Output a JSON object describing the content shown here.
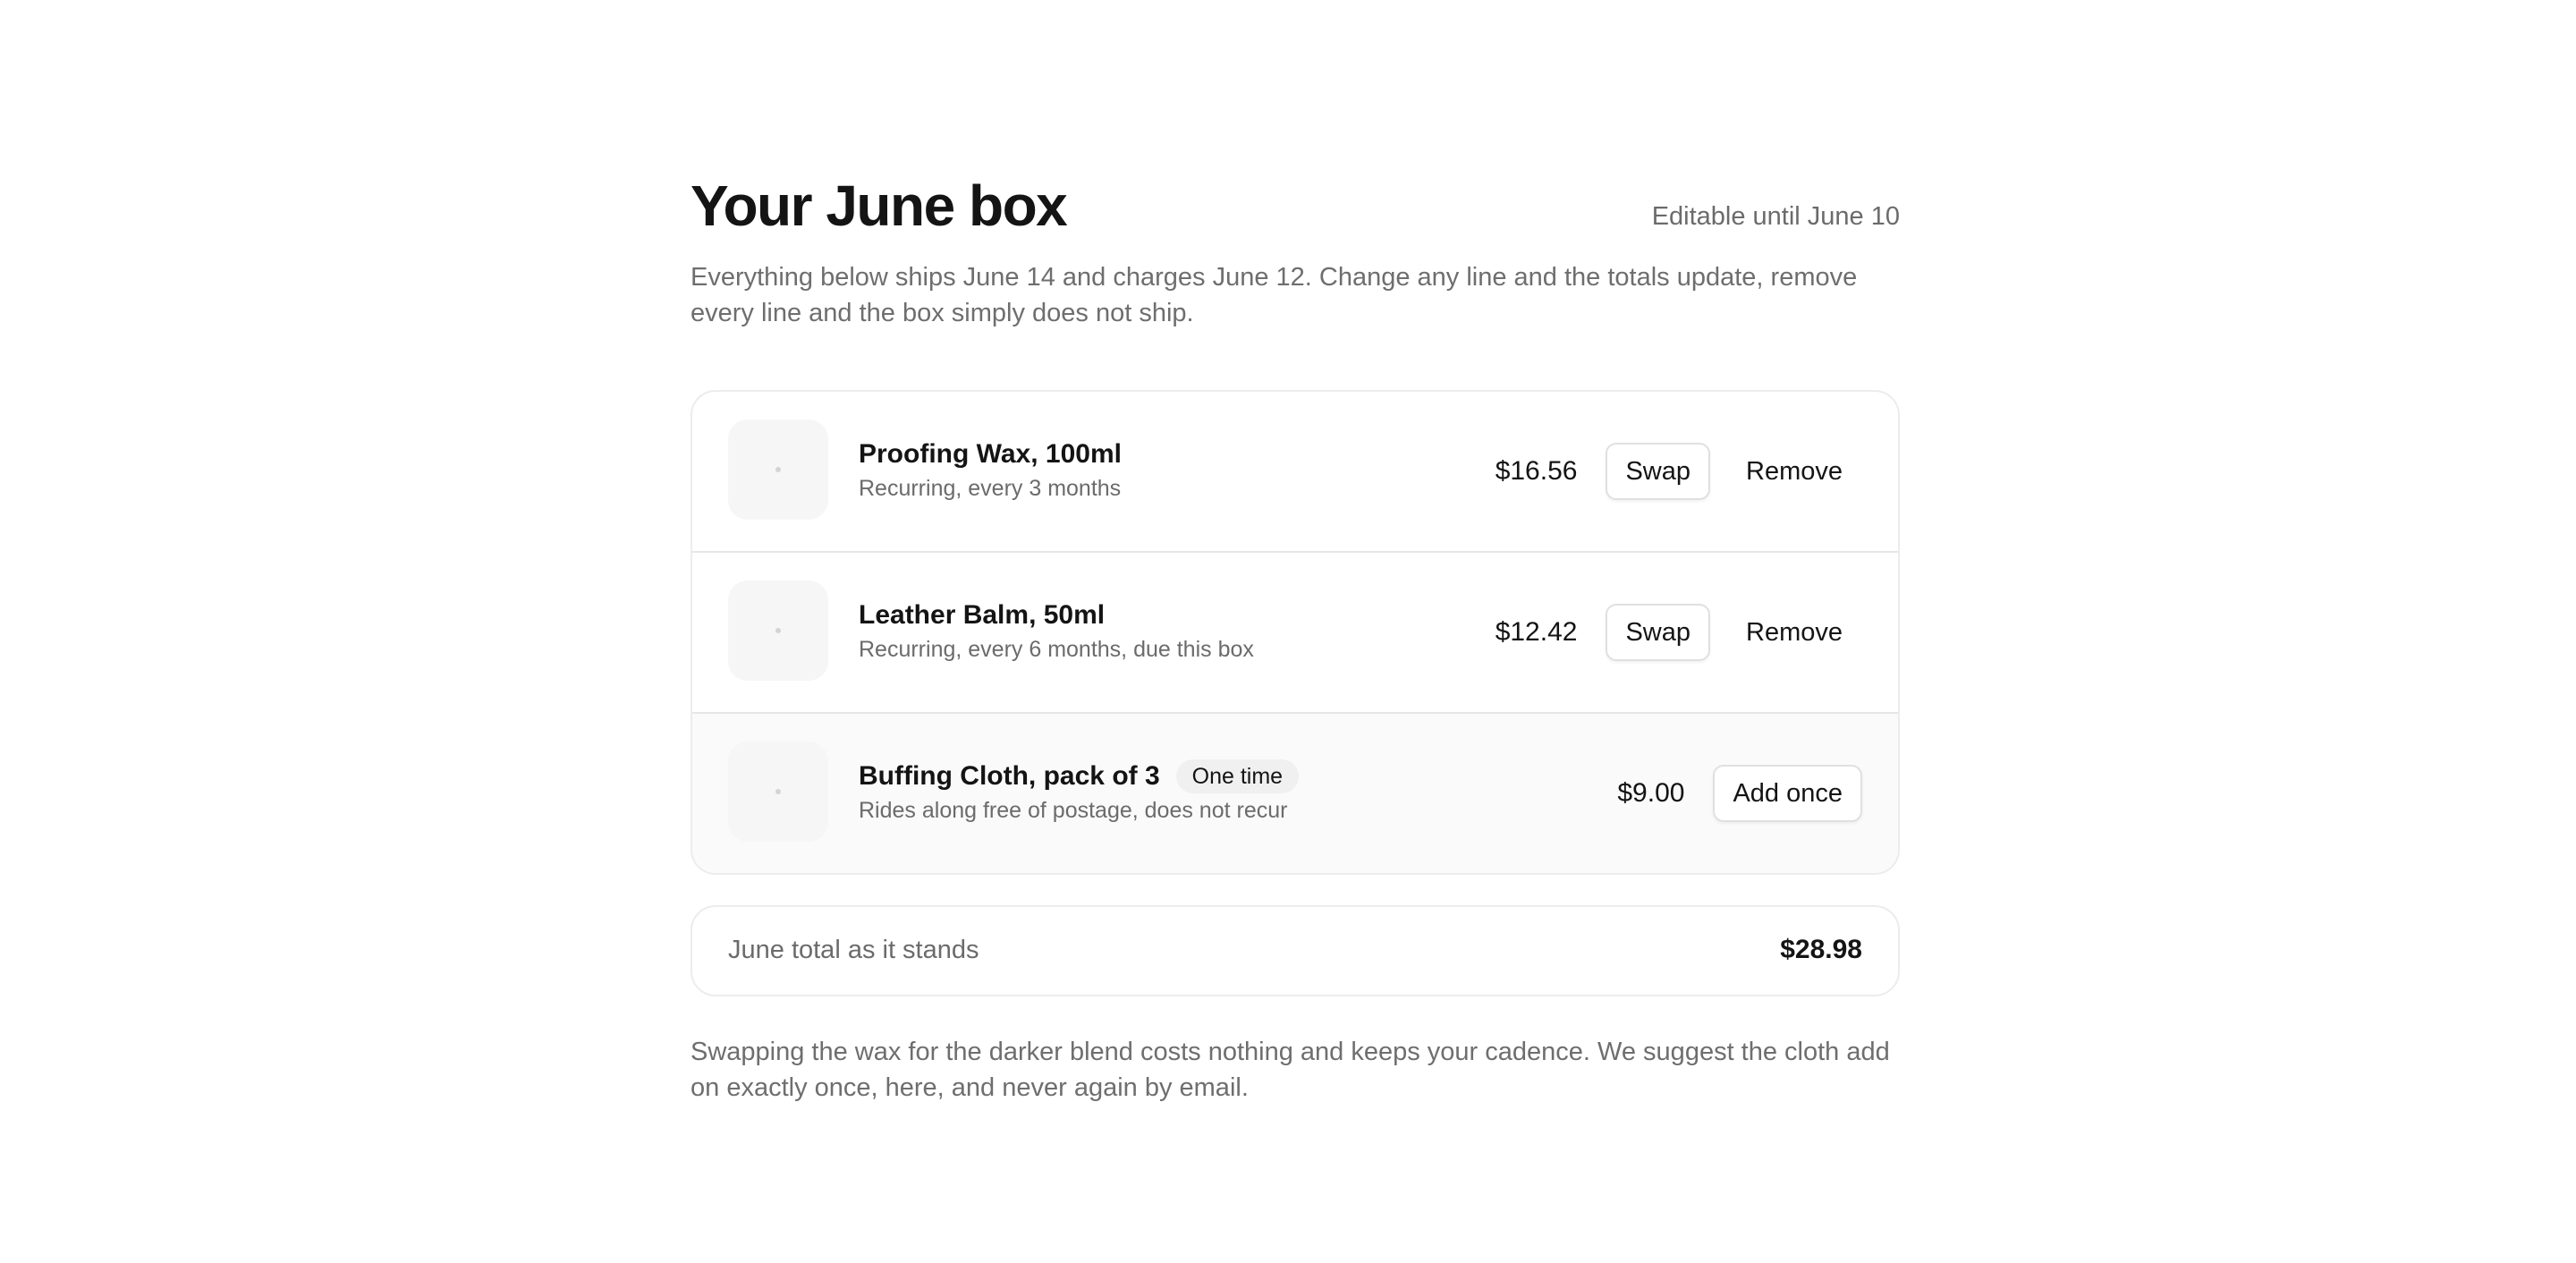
{
  "header": {
    "title": "Your June box",
    "editable_note": "Editable until June 10"
  },
  "intro": "Everything below ships June 14 and charges June 12. Change any line and the totals update, remove every line and the box simply does not ship.",
  "items": [
    {
      "name": "Proofing Wax, 100ml",
      "subtitle": "Recurring, every 3 months",
      "price": "$16.56",
      "swap_label": "Swap",
      "remove_label": "Remove"
    },
    {
      "name": "Leather Balm, 50ml",
      "subtitle": "Recurring, every 6 months, due this box",
      "price": "$12.42",
      "swap_label": "Swap",
      "remove_label": "Remove"
    }
  ],
  "upsell": {
    "name": "Buffing Cloth, pack of 3",
    "badge": "One time",
    "subtitle": "Rides along free of postage, does not recur",
    "price": "$9.00",
    "add_label": "Add once"
  },
  "total": {
    "label": "June total as it stands",
    "value": "$28.98"
  },
  "footnote": "Swapping the wax for the darker blend costs nothing and keeps your cadence. We suggest the cloth add on exactly once, here, and never again by email.",
  "colors": {
    "text": "#141414",
    "muted": "#6b6b6b",
    "border": "#ececec",
    "upsell_bg": "#fafafa"
  }
}
